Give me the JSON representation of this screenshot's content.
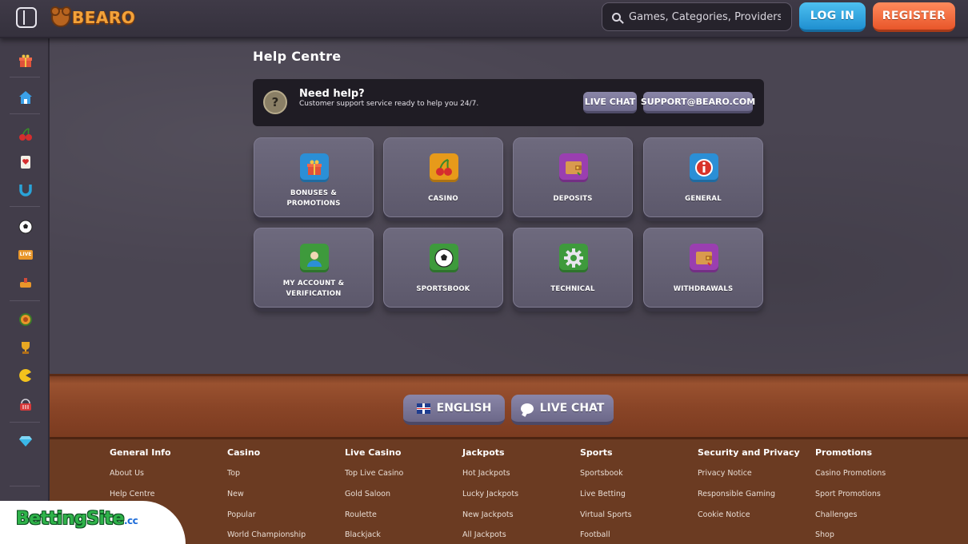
{
  "header": {
    "logo_text": "BEARO",
    "search_placeholder": "Games, Categories, Providers",
    "login_label": "LOG IN",
    "register_label": "REGISTER"
  },
  "sidebar": {
    "icons": [
      "gift-icon",
      "home-icon",
      "cherry-icon",
      "card-icon",
      "horseshoe-icon",
      "football-icon",
      "live-icon",
      "sports-icon",
      "bear-badge-icon",
      "trophy-icon",
      "pacman-icon",
      "basket-icon",
      "diamond-icon"
    ],
    "live_badge": "LIVE"
  },
  "main": {
    "title": "Help Centre",
    "help": {
      "title": "Need help?",
      "subtitle": "Customer support service ready to help you 24/7.",
      "live_chat": "LIVE CHAT",
      "email": "SUPPORT@BEARO.COM"
    },
    "categories": [
      {
        "line1": "BONUSES &",
        "line2": "PROMOTIONS",
        "icon": "gift-icon",
        "color": "#2b8fd6"
      },
      {
        "line1": "CASINO",
        "line2": "",
        "icon": "cherry-icon",
        "color": "#e79a1a"
      },
      {
        "line1": "DEPOSITS",
        "line2": "",
        "icon": "wallet-icon",
        "color": "#9a3fb0"
      },
      {
        "line1": "GENERAL",
        "line2": "",
        "icon": "info-icon",
        "color": "#2b8fd6"
      },
      {
        "line1": "MY ACCOUNT &",
        "line2": "VERIFICATION",
        "icon": "user-icon",
        "color": "#3e9a3c"
      },
      {
        "line1": "SPORTSBOOK",
        "line2": "",
        "icon": "football-icon",
        "color": "#3e9a3c"
      },
      {
        "line1": "TECHNICAL",
        "line2": "",
        "icon": "gear-icon",
        "color": "#3e9a3c"
      },
      {
        "line1": "WITHDRAWALS",
        "line2": "",
        "icon": "wallet-icon",
        "color": "#9a3fb0"
      }
    ]
  },
  "footer": {
    "language_label": "ENGLISH",
    "live_chat_label": "LIVE CHAT",
    "columns": [
      {
        "title": "General Info",
        "links": [
          "About Us",
          "Help Centre",
          "",
          ""
        ]
      },
      {
        "title": "Casino",
        "links": [
          "Top",
          "New",
          "Popular",
          "World Championship"
        ]
      },
      {
        "title": "Live Casino",
        "links": [
          "Top Live Casino",
          "Gold Saloon",
          "Roulette",
          "Blackjack"
        ]
      },
      {
        "title": "Jackpots",
        "links": [
          "Hot Jackpots",
          "Lucky Jackpots",
          "New Jackpots",
          "All Jackpots"
        ]
      },
      {
        "title": "Sports",
        "links": [
          "Sportsbook",
          "Live Betting",
          "Virtual Sports",
          "Football"
        ]
      },
      {
        "title": "Security and Privacy",
        "links": [
          "Privacy Notice",
          "Responsible Gaming",
          "Cookie Notice",
          ""
        ]
      },
      {
        "title": "Promotions",
        "links": [
          "Casino Promotions",
          "Sport Promotions",
          "Challenges",
          "Shop"
        ]
      }
    ]
  },
  "watermark": {
    "text": "BettingSite",
    "suffix": ".cc"
  }
}
